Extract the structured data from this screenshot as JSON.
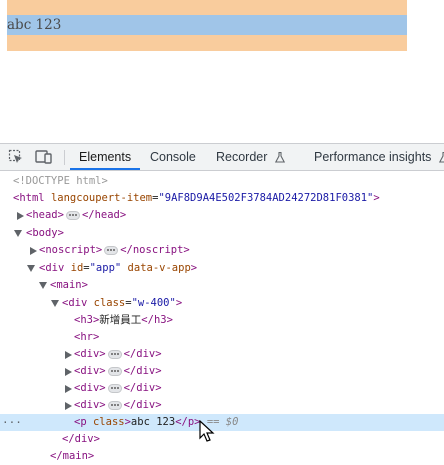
{
  "preview": {
    "p_text": "abc 123"
  },
  "toolbar": {
    "tabs": [
      {
        "label": "Elements",
        "active": true
      },
      {
        "label": "Console",
        "active": false
      },
      {
        "label": "Recorder",
        "active": false
      },
      {
        "label": "Performance insights",
        "active": false
      }
    ]
  },
  "dom": {
    "doctype": "<!DOCTYPE html>",
    "html": {
      "tag": "html",
      "attrs": [
        {
          "name": "lang",
          "value": ""
        },
        {
          "name": "coupert-item",
          "value": "\"9AF8D9A4E502F3784AD24272D81F0381\""
        }
      ]
    },
    "head_open": "<head>",
    "head_close": "</head>",
    "body_open": "<body>",
    "noscript_open": "<noscript>",
    "noscript_close": "</noscript>",
    "app_div": {
      "tag": "div",
      "id_attr": "id",
      "id_val": "\"app\"",
      "extra_attr": "data-v-app"
    },
    "main_open": "<main>",
    "w400_div": {
      "class_attr": "class",
      "class_val": "\"w-400\""
    },
    "h3_text": "新增員工",
    "hr": "<hr>",
    "div_open": "<div>",
    "div_close": "</div>",
    "p_class_attr": "class",
    "p_text": "abc 123",
    "p_close": "</p>",
    "selected_marker": "== $0",
    "div_end": "</div>",
    "main_end": "</main>"
  },
  "colors": {
    "margin_orange": "#f9cc9d",
    "content_blue": "#a0c5e8",
    "selected_row": "#cfe8fc",
    "tag_purple": "#881280",
    "attr_orange": "#994500",
    "val_blue": "#1a1aa6",
    "active_tab_underline": "#1a73e8"
  },
  "icons": [
    "inspect-element-icon",
    "device-toolbar-icon",
    "flask-icon",
    "expand-triangle-icon",
    "collapse-triangle-icon",
    "ellipsis-icon",
    "mouse-cursor-icon"
  ]
}
